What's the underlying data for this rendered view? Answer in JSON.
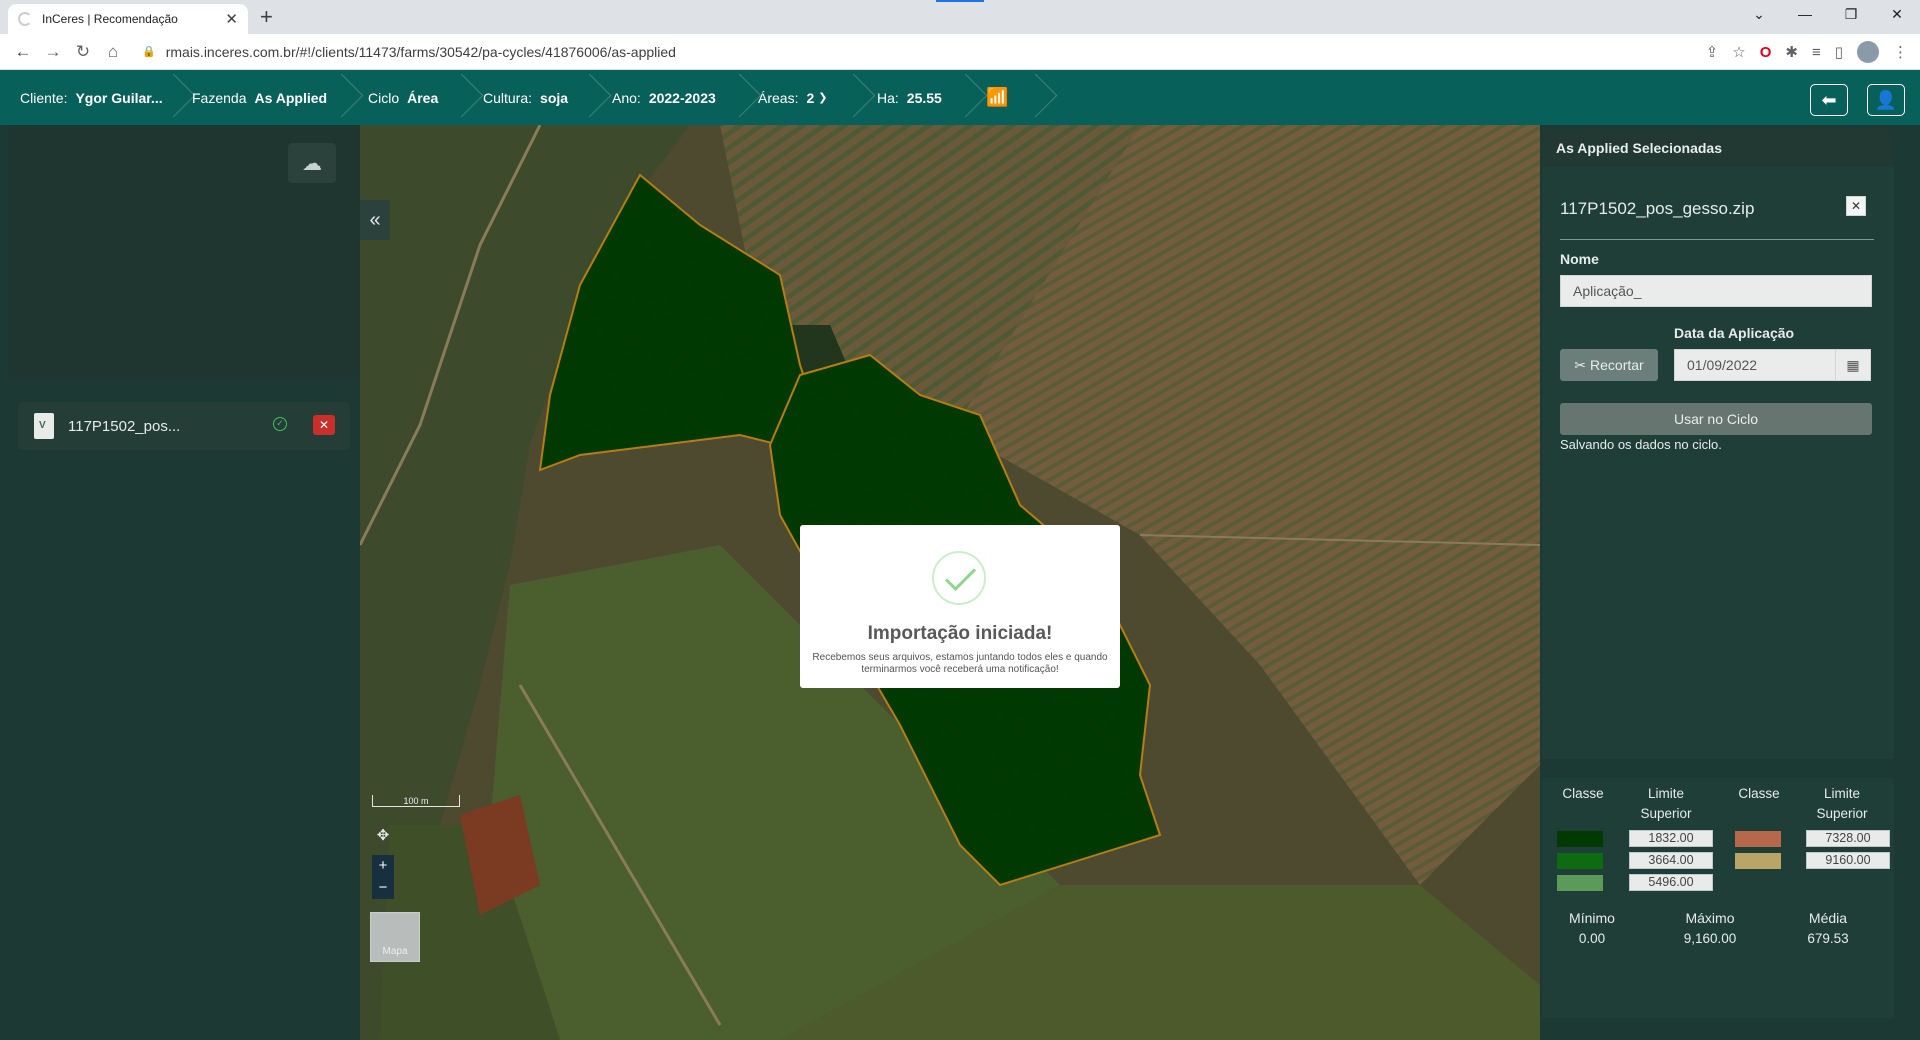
{
  "browser": {
    "tab_title": "InCeres | Recomendação",
    "url": "rmais.inceres.com.br/#!/clients/11473/farms/30542/pa-cycles/41876006/as-applied"
  },
  "header": {
    "cliente_label": "Cliente:",
    "cliente_value": "Ygor Guilar...",
    "fazenda_label": "Fazenda",
    "fazenda_value": "As Applied",
    "ciclo_label": "Ciclo",
    "ciclo_value": "Área",
    "cultura_label": "Cultura:",
    "cultura_value": "soja",
    "ano_label": "Ano:",
    "ano_value": "2022-2023",
    "areas_label": "Áreas:",
    "areas_value": "2",
    "ha_label": "Ha:",
    "ha_value": "25.55"
  },
  "sidebar": {
    "file_name": "117P1502_pos..."
  },
  "map": {
    "scale_label": "100 m",
    "thumb_label": "Mapa"
  },
  "modal": {
    "title": "Importação iniciada!",
    "text": "Recebemos seus arquivos, estamos juntando todos eles e quando terminarmos você receberá uma notificação!"
  },
  "panel": {
    "title": "As Applied Selecionadas",
    "file_name": "117P1502_pos_gesso.zip",
    "nome_label": "Nome",
    "nome_value": "Aplicação_",
    "date_label": "Data da Aplicação",
    "recortar_label": "Recortar",
    "date_value": "01/09/2022",
    "usar_label": "Usar no Ciclo",
    "status": "Salvando os dados no ciclo."
  },
  "legend": {
    "classe_label": "Classe",
    "limite_label": "Limite Superior",
    "classes_left": [
      {
        "color": "#013a01",
        "value": "1832.00"
      },
      {
        "color": "#0d6b12",
        "value": "3664.00"
      },
      {
        "color": "#5c9a5a",
        "value": "5496.00"
      }
    ],
    "classes_right": [
      {
        "color": "#b8684a",
        "value": "7328.00"
      },
      {
        "color": "#b9a565",
        "value": "9160.00"
      }
    ],
    "min_label": "Mínimo",
    "min_value": "0.00",
    "max_label": "Máximo",
    "max_value": "9,160.00",
    "avg_label": "Média",
    "avg_value": "679.53"
  }
}
